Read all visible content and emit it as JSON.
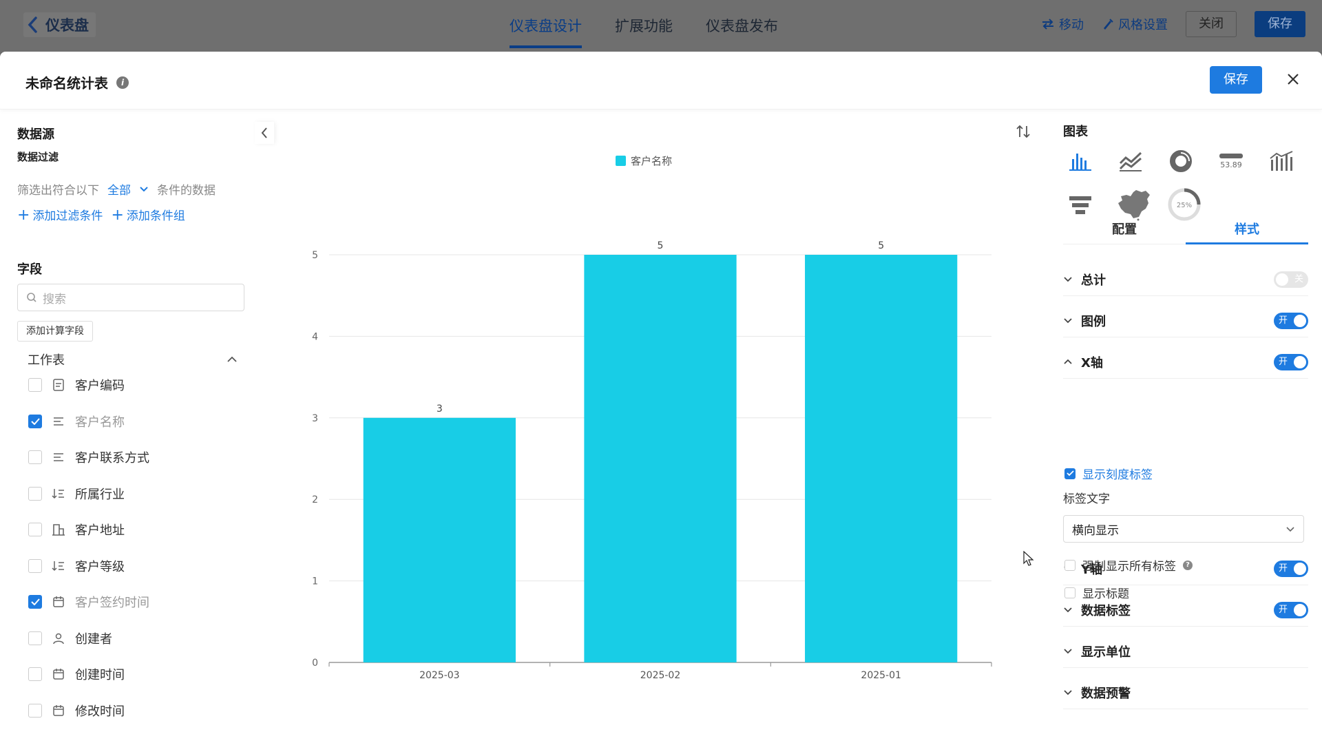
{
  "topbar": {
    "back_label": "仪表盘",
    "tabs": [
      {
        "label": "仪表盘设计",
        "active": true
      },
      {
        "label": "扩展功能",
        "active": false
      },
      {
        "label": "仪表盘发布",
        "active": false
      }
    ],
    "move_label": "移动",
    "style_label": "风格设置",
    "close_label": "关闭",
    "save_label": "保存"
  },
  "modal": {
    "title": "未命名统计表",
    "save_label": "保存"
  },
  "left": {
    "datasource_title": "数据源",
    "filter_title": "数据过滤",
    "filter_prefix": "筛选出符合以下",
    "filter_scope": "全部",
    "filter_suffix": "条件的数据",
    "add_filter": "添加过滤条件",
    "add_group": "添加条件组",
    "fields_title": "字段",
    "search_placeholder": "搜索",
    "calc_field_button": "添加计算字段",
    "sheet_label": "工作表",
    "fields": [
      {
        "label": "客户编码",
        "icon": "text-field-icon",
        "checked": false
      },
      {
        "label": "客户名称",
        "icon": "text-lines-icon",
        "checked": true
      },
      {
        "label": "客户联系方式",
        "icon": "text-lines-icon",
        "checked": false
      },
      {
        "label": "所属行业",
        "icon": "sort-list-icon",
        "checked": false
      },
      {
        "label": "客户地址",
        "icon": "building-icon",
        "checked": false
      },
      {
        "label": "客户等级",
        "icon": "sort-list-icon",
        "checked": false
      },
      {
        "label": "客户签约时间",
        "icon": "calendar-icon",
        "checked": true
      },
      {
        "label": "创建者",
        "icon": "user-icon",
        "checked": false
      },
      {
        "label": "创建时间",
        "icon": "calendar-icon",
        "checked": false
      },
      {
        "label": "修改时间",
        "icon": "calendar-icon",
        "checked": false
      }
    ]
  },
  "chart_data": {
    "type": "bar",
    "legend": [
      "客户名称"
    ],
    "categories": [
      "2025-03",
      "2025-02",
      "2025-01"
    ],
    "series": [
      {
        "name": "客户名称",
        "values": [
          3,
          5,
          5
        ],
        "color": "#18cde6"
      }
    ],
    "y_ticks": [
      0,
      1,
      2,
      3,
      4,
      5
    ],
    "ylim": [
      0,
      5
    ],
    "grid": true,
    "data_labels": true,
    "legend_position": "top-center"
  },
  "right": {
    "title": "图表",
    "chart_types": [
      "bar-chart-icon",
      "line-chart-icon",
      "donut-chart-icon",
      "indicator-icon",
      "combo-chart-icon",
      "funnel-chart-icon",
      "map-chart-icon",
      "gauge-chart-icon"
    ],
    "indicator_value": "53.89",
    "gauge_value": "25%",
    "tabs": [
      {
        "label": "配置",
        "active": false
      },
      {
        "label": "样式",
        "active": true
      }
    ],
    "options": [
      {
        "label": "总计",
        "toggle": "关",
        "on": false,
        "expanded": false
      },
      {
        "label": "图例",
        "toggle": "开",
        "on": true,
        "expanded": false
      },
      {
        "label": "X轴",
        "toggle": "开",
        "on": true,
        "expanded": true
      },
      {
        "label": "Y轴",
        "toggle": "开",
        "on": true,
        "expanded": false
      },
      {
        "label": "数据标签",
        "toggle": "开",
        "on": true,
        "expanded": false
      },
      {
        "label": "显示单位",
        "toggle": "",
        "on": false,
        "expanded": false
      },
      {
        "label": "数据预警",
        "toggle": "",
        "on": false,
        "expanded": false
      }
    ],
    "xaxis": {
      "show_ticks_label": "显示刻度标签",
      "label_text_title": "标签文字",
      "label_direction": "横向显示",
      "force_all_labels": "强制显示所有标签",
      "show_title": "显示标题"
    }
  },
  "colors": {
    "accent": "#1e7be0",
    "bar": "#18cde6"
  }
}
